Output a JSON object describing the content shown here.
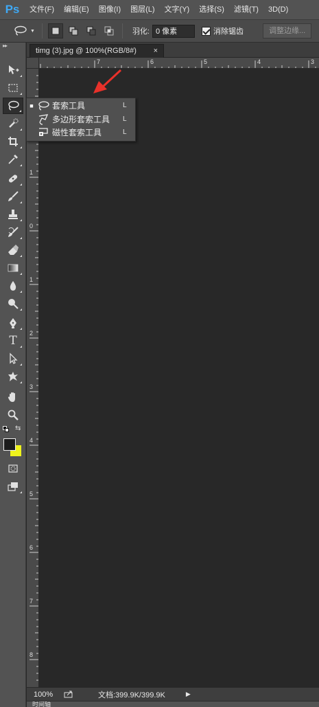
{
  "app": {
    "logo": "Ps"
  },
  "menu": [
    "文件(F)",
    "编辑(E)",
    "图像(I)",
    "图层(L)",
    "文字(Y)",
    "选择(S)",
    "滤镜(T)",
    "3D(D)"
  ],
  "options": {
    "feather_label": "羽化:",
    "feather_value": "0 像素",
    "antialias_label": "消除锯齿",
    "antialias_checked": true,
    "refine_label": "调整边缘..."
  },
  "document": {
    "tab_title": "timg (3).jpg @ 100%(RGB/8#)",
    "close_glyph": "×"
  },
  "ruler": {
    "top_labels": [
      "7",
      "6",
      "5",
      "4",
      "3"
    ],
    "left_labels": [
      "1",
      "0",
      "1",
      "2",
      "3",
      "4",
      "5",
      "6",
      "7",
      "8"
    ]
  },
  "flyout": {
    "items": [
      {
        "label": "套索工具",
        "shortcut": "L",
        "selected": true,
        "icon": "lasso-icon"
      },
      {
        "label": "多边形套索工具",
        "shortcut": "L",
        "selected": false,
        "icon": "polygonal-lasso-icon"
      },
      {
        "label": "磁性套索工具",
        "shortcut": "L",
        "selected": false,
        "icon": "magnetic-lasso-icon"
      }
    ]
  },
  "status": {
    "zoom": "100%",
    "doc_size": "文档:399.9K/399.9K",
    "arrow": "▶"
  },
  "timeline": {
    "label": "时间轴"
  },
  "colors": {
    "foreground": "#1b1b1b",
    "background": "#eef21c",
    "arrow": "#e8312a",
    "logo": "#3fa9f5"
  }
}
